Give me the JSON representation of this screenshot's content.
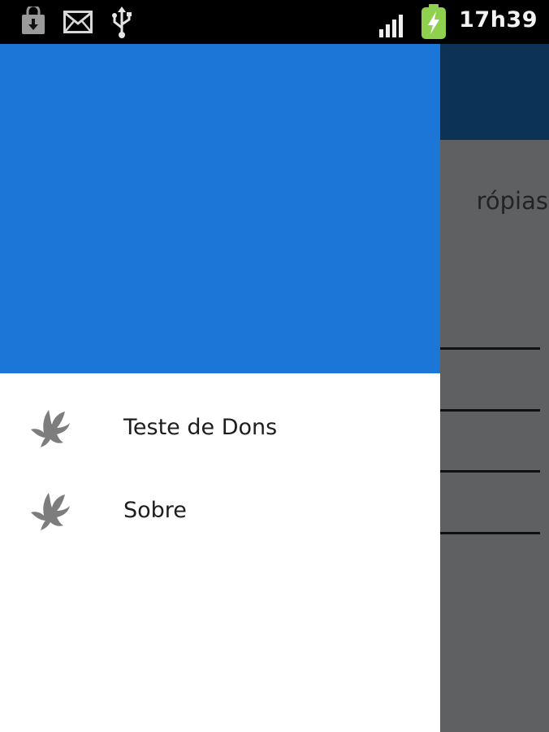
{
  "status_bar": {
    "time": "17h39",
    "icons": [
      "shopping-bag-download-icon",
      "mail-icon",
      "usb-icon",
      "signal-icon",
      "battery-charging-icon"
    ]
  },
  "background_app": {
    "visible_text": "rópias"
  },
  "drawer": {
    "items": [
      {
        "label": "Teste de Dons",
        "icon": "dove-icon"
      },
      {
        "label": "Sobre",
        "icon": "dove-icon"
      }
    ]
  },
  "colors": {
    "drawer_header": "#1b76d7",
    "action_bar": "#0c3356",
    "scrim": "#5f6062"
  }
}
